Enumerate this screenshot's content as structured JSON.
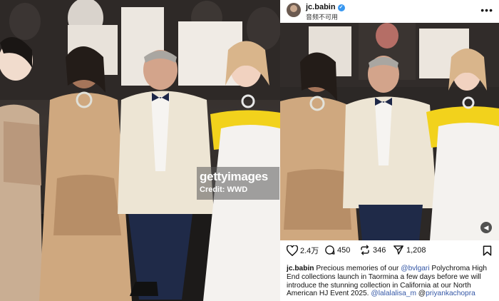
{
  "left_photo": {
    "watermark_brand": "gettyimages",
    "watermark_credit": "Credit: WWD"
  },
  "post": {
    "username": "jc.babin",
    "sublabel": "音频不可用",
    "icons": {
      "more": "more-horizontal-icon",
      "verified": "verified-badge-icon",
      "mute": "muted-speaker-icon",
      "like": "heart-icon",
      "comment": "comment-icon",
      "repost": "repost-icon",
      "share": "send-icon",
      "save": "bookmark-icon"
    },
    "likes": "2.4万",
    "comments": "450",
    "reposts": "346",
    "shares": "1,208",
    "caption": {
      "author": "jc.babin",
      "text_1": " Precious memories of our ",
      "mention_1": "@bvlgari",
      "text_2": " Polychroma High End collections  launch in Taormina a few days before we will introduce the stunning collection in California at our North American HJ Event 2025. ",
      "mention_2": "@lalalalisa_m",
      "text_3": " @",
      "mention_3": "priyankachopra"
    }
  }
}
